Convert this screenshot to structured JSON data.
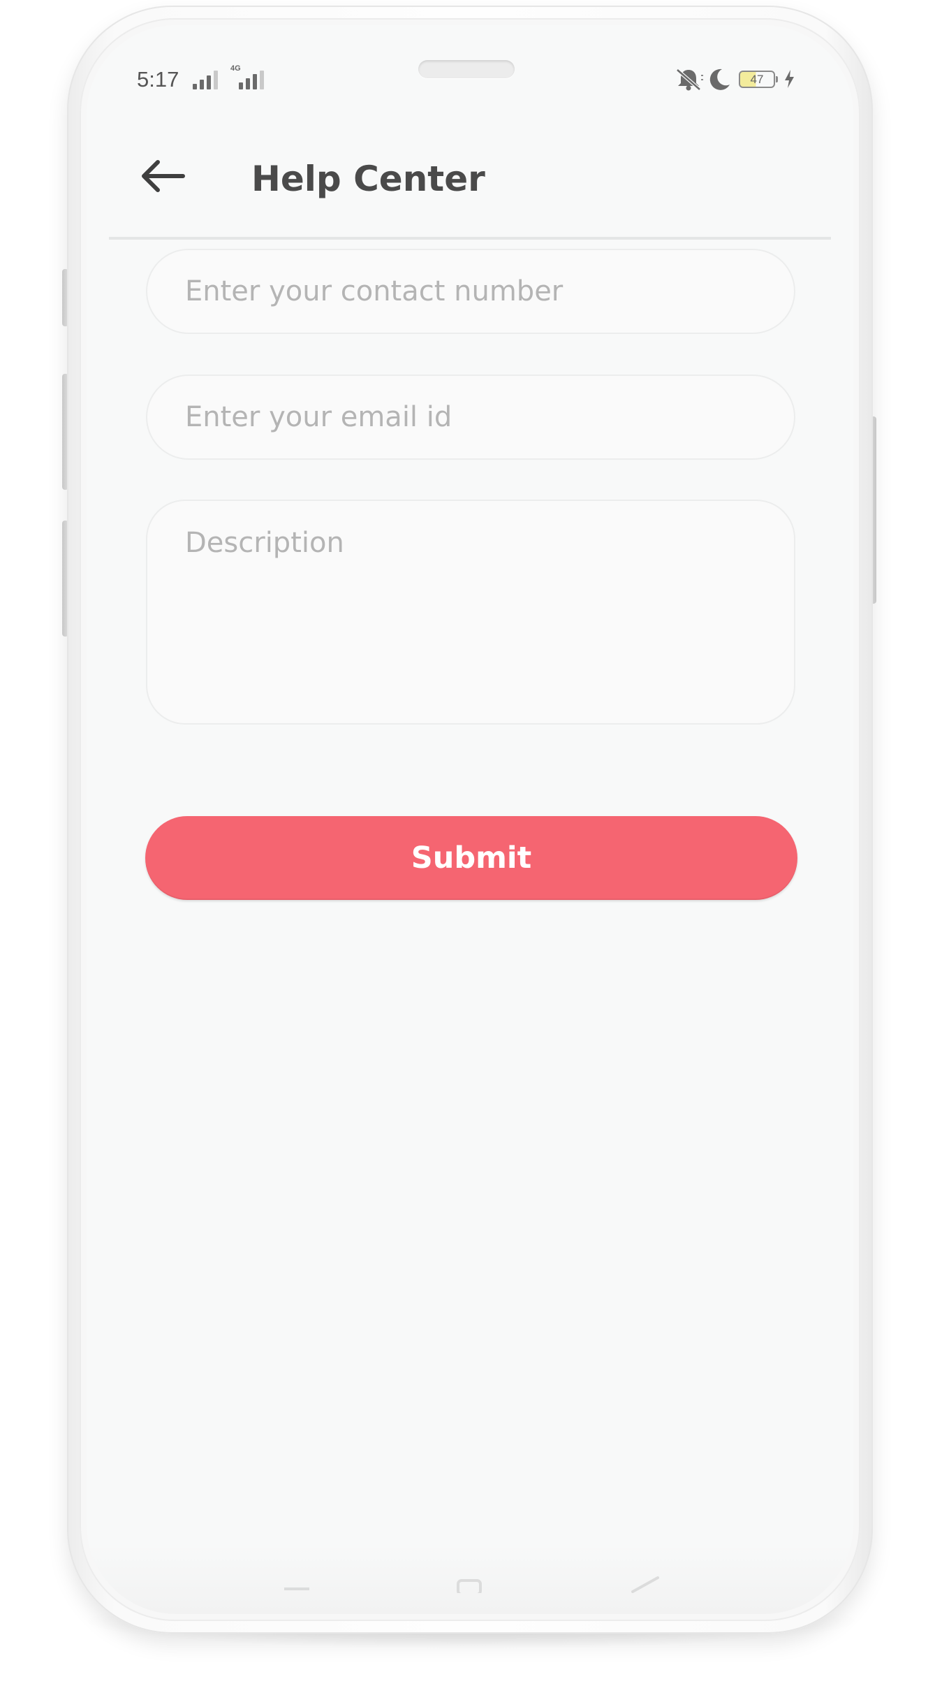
{
  "status_bar": {
    "time": "5:17",
    "network_type": "4G",
    "battery_level": "47",
    "icons": [
      "signal-icon",
      "signal-4g-icon",
      "mute-icon",
      "do-not-disturb-icon",
      "battery-icon",
      "charging-icon"
    ]
  },
  "app_bar": {
    "back_icon": "arrow-left-icon",
    "title": "Help Center"
  },
  "form": {
    "contact": {
      "value": "",
      "placeholder": "Enter your contact number"
    },
    "email": {
      "value": "",
      "placeholder": "Enter your email id"
    },
    "description": {
      "value": "",
      "placeholder": "Description"
    },
    "submit_label": "Submit"
  },
  "colors": {
    "accent": "#f56571",
    "title_text": "#4a4a4a",
    "placeholder_text": "#b4b4b4",
    "background": "#f8f9f9"
  }
}
